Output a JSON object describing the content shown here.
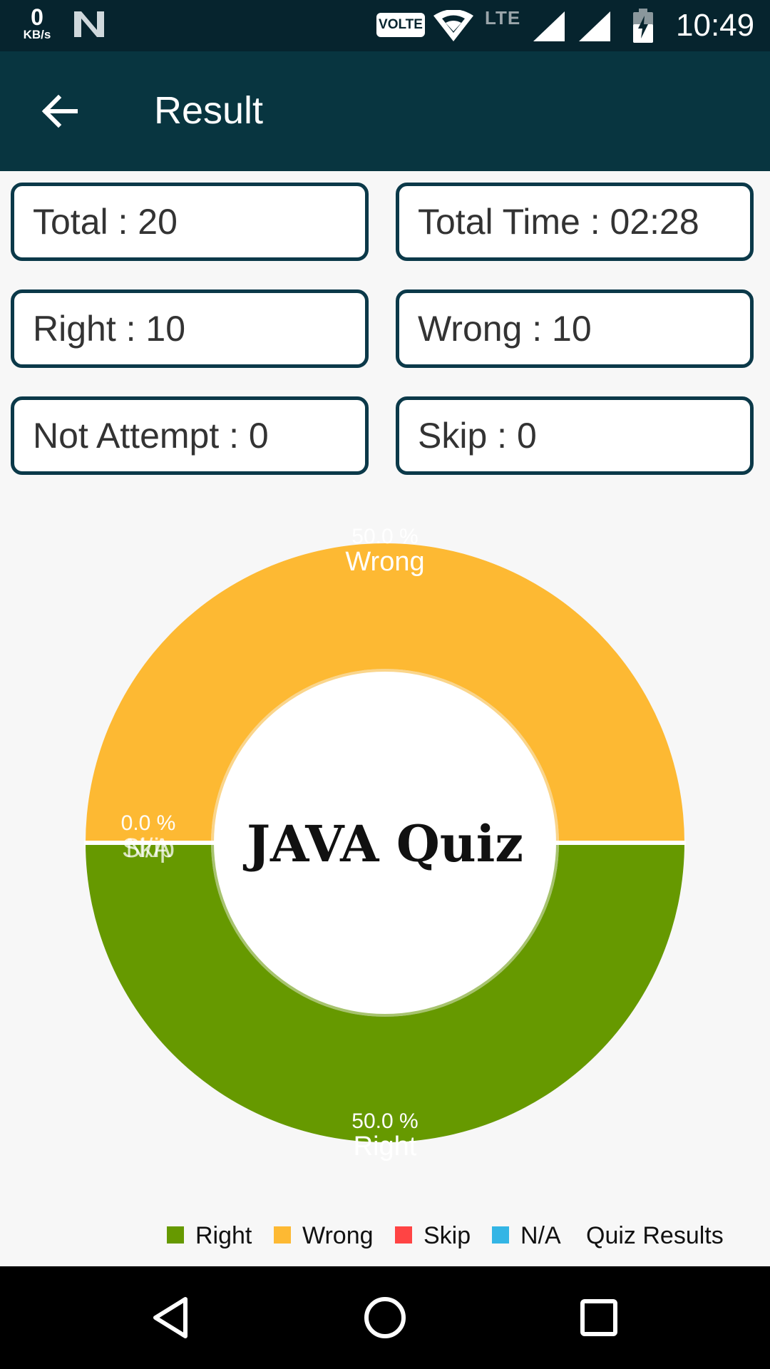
{
  "status_bar": {
    "net_speed_value": "0",
    "net_speed_unit": "KB/s",
    "volte_label": "VOLTE",
    "lte_label": "LTE",
    "time": "10:49"
  },
  "app_bar": {
    "title": "Result",
    "back_icon": "arrow-left-icon"
  },
  "stats": {
    "total": "Total : 20",
    "total_time": "Total Time : 02:28",
    "right": "Right : 10",
    "wrong": "Wrong : 10",
    "not_attempt": "Not Attempt : 0",
    "skip": "Skip : 0"
  },
  "chart_data": {
    "type": "pie",
    "center_text": "JAVA Quiz",
    "description": "Quiz Results",
    "slices": [
      {
        "label": "Wrong",
        "percent": 50.0,
        "value_label": "50.0 %",
        "color": "#fdb933"
      },
      {
        "label": "Right",
        "percent": 50.0,
        "value_label": "50.0 %",
        "color": "#669900"
      },
      {
        "label": "Skip",
        "percent": 0.0,
        "value_label": "0.0 %",
        "color": "#ff4444"
      },
      {
        "label": "N/A",
        "percent": 0.0,
        "value_label": "0.0 %",
        "color": "#33b5e5"
      }
    ],
    "legend": [
      {
        "label": "Right",
        "color": "#669900"
      },
      {
        "label": "Wrong",
        "color": "#fdb933"
      },
      {
        "label": "Skip",
        "color": "#ff4444"
      },
      {
        "label": "N/A",
        "color": "#33b5e5"
      }
    ],
    "legend_placement": "bottom-right"
  },
  "nav_bar": {
    "back_icon": "triangle-back-icon",
    "home_icon": "circle-home-icon",
    "recents_icon": "square-recents-icon"
  }
}
